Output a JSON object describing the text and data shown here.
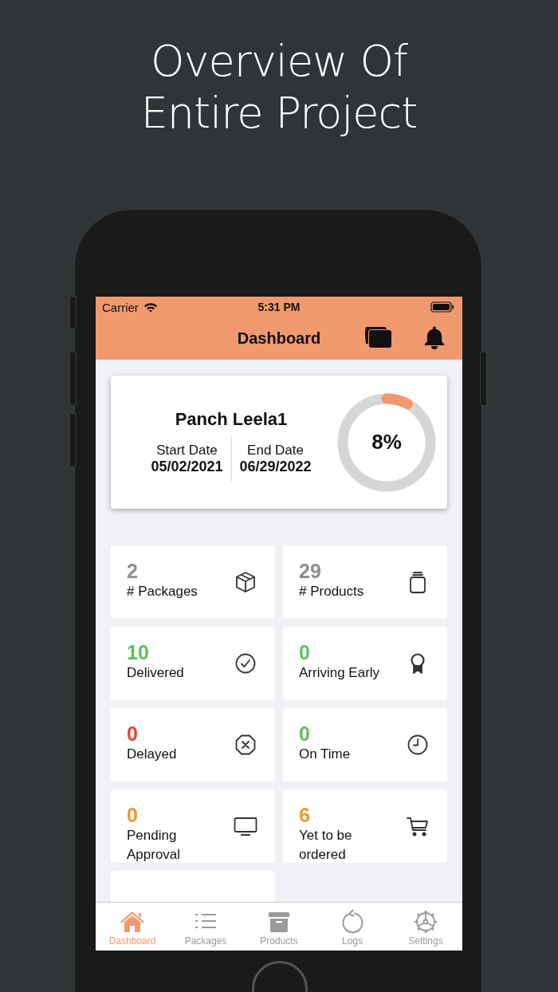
{
  "headline": [
    "Overview Of",
    "Entire Project"
  ],
  "status_bar": {
    "carrier": "Carrier",
    "time": "5:31 PM"
  },
  "nav_bar": {
    "title": "Dashboard"
  },
  "project": {
    "name": "Panch Leela1",
    "start_label": "Start Date",
    "start_date": "05/02/2021",
    "end_label": "End Date",
    "end_date": "06/29/2022",
    "progress_text": "8%",
    "level": 0.08
  },
  "stats": [
    {
      "value": "2",
      "label": "# Packages",
      "color": "#8e8e93",
      "kind": "box"
    },
    {
      "value": "29",
      "label": "# Products",
      "color": "#8e8e93",
      "kind": "jar"
    },
    {
      "value": "10",
      "label": "Delivered",
      "color": "#5cc15c",
      "kind": "check"
    },
    {
      "value": "0",
      "label": "Arriving Early",
      "color": "#5cc15c",
      "kind": "award"
    },
    {
      "value": "0",
      "label": "Delayed",
      "color": "#e8453c",
      "kind": "cross"
    },
    {
      "value": "0",
      "label": "On Time",
      "color": "#5cc15c",
      "kind": "clock"
    },
    {
      "value": "0",
      "label": "Pending Approval",
      "color": "#f0962e",
      "kind": "monitor"
    },
    {
      "value": "6",
      "label": "Yet to be ordered",
      "color": "#f0962e",
      "kind": "cart"
    }
  ],
  "tabs": [
    {
      "label": "Dashboard",
      "selected": true,
      "kind": "home"
    },
    {
      "label": "Packages",
      "selected": false,
      "kind": "list"
    },
    {
      "label": "Products",
      "selected": false,
      "kind": "archive"
    },
    {
      "label": "Logs",
      "selected": false,
      "kind": "logs"
    },
    {
      "label": "Settings",
      "selected": false,
      "kind": "settings"
    }
  ]
}
